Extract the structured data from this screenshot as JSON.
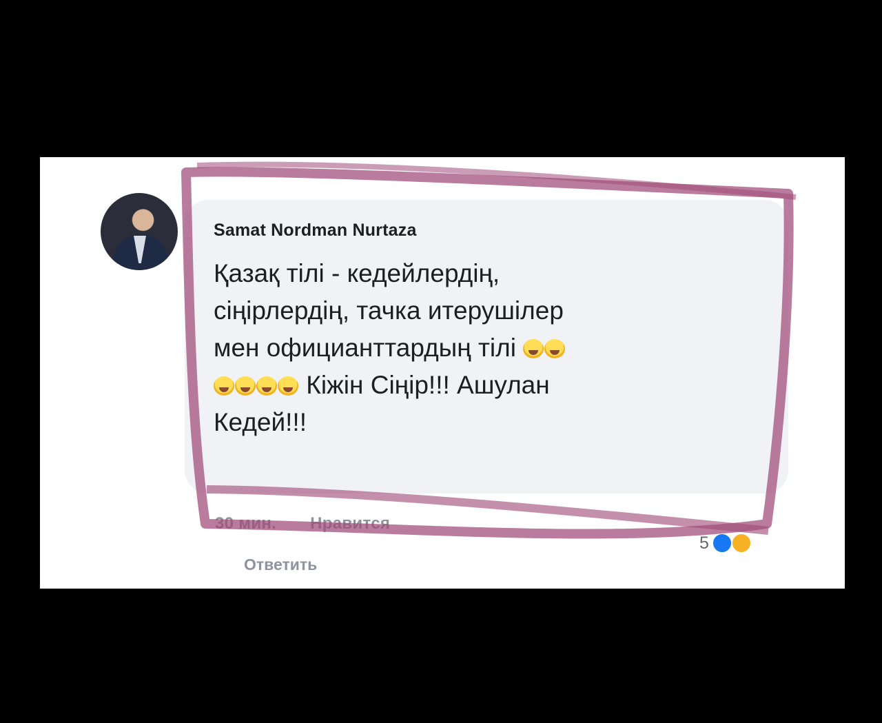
{
  "comment": {
    "author": "Samat Nordman Nurtaza",
    "text_line1": "Қазақ тілі - кедейлердің,",
    "text_line2": "сіңірлердің, тачка итерушілер",
    "text_line3_prefix": "мен официанттардың тілі",
    "text_line4_suffix": "Кіжін Сіңір!!! Ашулан",
    "text_line5": "Кедей!!!",
    "line3_emoji_count": 2,
    "line4_emoji_count": 4
  },
  "actions": {
    "time": "30 мин.",
    "like": "Нравится",
    "reply": "Ответить"
  },
  "reactions": {
    "count": "5",
    "icons": [
      "like-icon",
      "haha-icon"
    ]
  },
  "colors": {
    "background": "#000000",
    "card": "#ffffff",
    "bubble": "#f0f2f5",
    "marker": "#a04a78"
  }
}
